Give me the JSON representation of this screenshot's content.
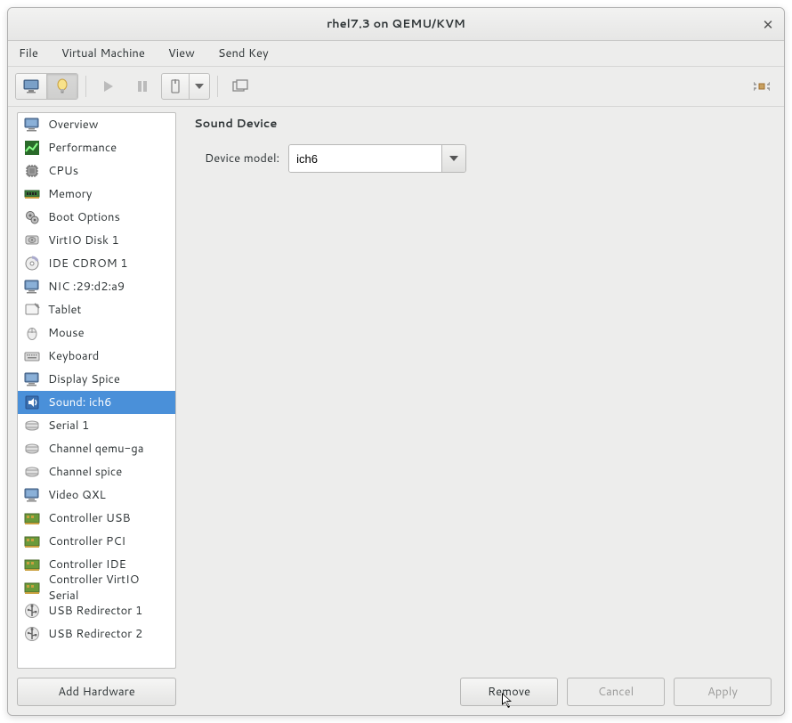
{
  "window": {
    "title": "rhel7.3 on QEMU/KVM"
  },
  "menu": {
    "file": "File",
    "virtual_machine": "Virtual Machine",
    "view": "View",
    "send_key": "Send Key"
  },
  "sidebar": {
    "items": [
      {
        "label": "Overview",
        "icon": "monitor-icon"
      },
      {
        "label": "Performance",
        "icon": "chart-icon"
      },
      {
        "label": "CPUs",
        "icon": "cpu-icon"
      },
      {
        "label": "Memory",
        "icon": "ram-icon"
      },
      {
        "label": "Boot Options",
        "icon": "gear-icon"
      },
      {
        "label": "VirtIO Disk 1",
        "icon": "disk-icon"
      },
      {
        "label": "IDE CDROM 1",
        "icon": "cdrom-icon"
      },
      {
        "label": "NIC :29:d2:a9",
        "icon": "nic-icon"
      },
      {
        "label": "Tablet",
        "icon": "tablet-icon"
      },
      {
        "label": "Mouse",
        "icon": "mouse-icon"
      },
      {
        "label": "Keyboard",
        "icon": "keyboard-icon"
      },
      {
        "label": "Display Spice",
        "icon": "display-icon"
      },
      {
        "label": "Sound: ich6",
        "icon": "sound-icon",
        "selected": true
      },
      {
        "label": "Serial 1",
        "icon": "serial-icon"
      },
      {
        "label": "Channel qemu-ga",
        "icon": "channel-icon"
      },
      {
        "label": "Channel spice",
        "icon": "channel-icon"
      },
      {
        "label": "Video QXL",
        "icon": "video-icon"
      },
      {
        "label": "Controller USB",
        "icon": "controller-icon"
      },
      {
        "label": "Controller PCI",
        "icon": "controller-icon"
      },
      {
        "label": "Controller IDE",
        "icon": "controller-icon"
      },
      {
        "label": "Controller VirtIO Serial",
        "icon": "controller-icon"
      },
      {
        "label": "USB Redirector 1",
        "icon": "usb-icon"
      },
      {
        "label": "USB Redirector 2",
        "icon": "usb-icon"
      }
    ]
  },
  "details": {
    "title": "Sound Device",
    "device_model_label": "Device model:",
    "device_model_value": "ich6"
  },
  "buttons": {
    "add_hardware": "Add Hardware",
    "remove": "Remove",
    "cancel": "Cancel",
    "apply": "Apply"
  }
}
